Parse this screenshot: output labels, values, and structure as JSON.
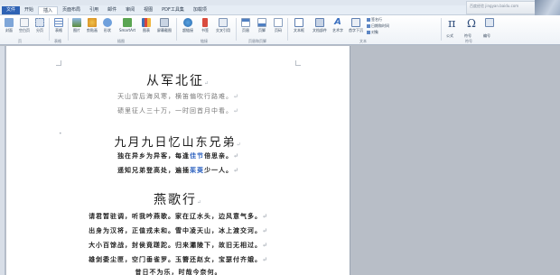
{
  "ribbon": {
    "tabs": [
      "文件",
      "开始",
      "插入",
      "页面布局",
      "引用",
      "邮件",
      "审阅",
      "视图",
      "PDF工具集",
      "加载项"
    ],
    "active_tab_index": 2,
    "brand_text": "百度经验 jingyan.baidu.com",
    "buttons": {
      "cover": "封面",
      "blank": "空白页",
      "pagebreak": "分页",
      "table": "表格",
      "picture": "图片",
      "clipart": "剪贴画",
      "shapes": "形状",
      "smartart": "SmartArt",
      "chart": "图表",
      "screenshot": "屏幕截图",
      "hyperlink": "超链接",
      "bookmark": "书签",
      "crossref": "交叉引用",
      "header": "页眉",
      "footer": "页脚",
      "pagenum": "页码",
      "textbox": "文本框",
      "quickparts": "文档部件",
      "wordart": "艺术字",
      "dropcap": "首字下沉",
      "signature": "签名行",
      "datetime": "日期和时间",
      "object": "对象",
      "equation": "公式",
      "symbol": "符号",
      "number": "编号"
    },
    "groups": [
      "页",
      "表格",
      "插图",
      "链接",
      "页眉和页脚",
      "文本",
      "符号"
    ],
    "symbols": {
      "pi": "π",
      "omega": "Ω"
    }
  },
  "document": {
    "poem1": {
      "title": "从军北征",
      "lines": [
        "天山雪后海风寒，横笛偏吹行路难。",
        "碛里征人三十万，一时回首月中看。"
      ]
    },
    "poem2": {
      "title": "九月九日忆山东兄弟",
      "lines": [
        {
          "before": "独在异乡为异客，每逢",
          "hl": "佳节",
          "after": "倍思亲。"
        },
        {
          "before": "遥知兄弟登高处，遍插",
          "hl": "茱萸",
          "after": "少一人。"
        }
      ]
    },
    "poem3": {
      "title": "燕歌行",
      "lines": [
        "请君暂驻调，听我吟燕歌。家在辽水头，边风意气多。",
        "出身为汉将，正值戎未和。雪中凌天山，冰上渡交河。",
        "大小百馀战，封侯竟蹉跎。归来灞陵下，故旧无相过。",
        "雄剑委尘匣，空门垂雀罗。玉簪还赵女，宝瑟付齐娥。",
        "昔日不为乐，时哉今奈何。"
      ]
    },
    "para_mark": "↵",
    "bullet_mark": "•"
  },
  "colors": {
    "file_tab": "#2e62b4",
    "highlight_text": "#2f63c0",
    "workspace": "#b8bec7"
  }
}
